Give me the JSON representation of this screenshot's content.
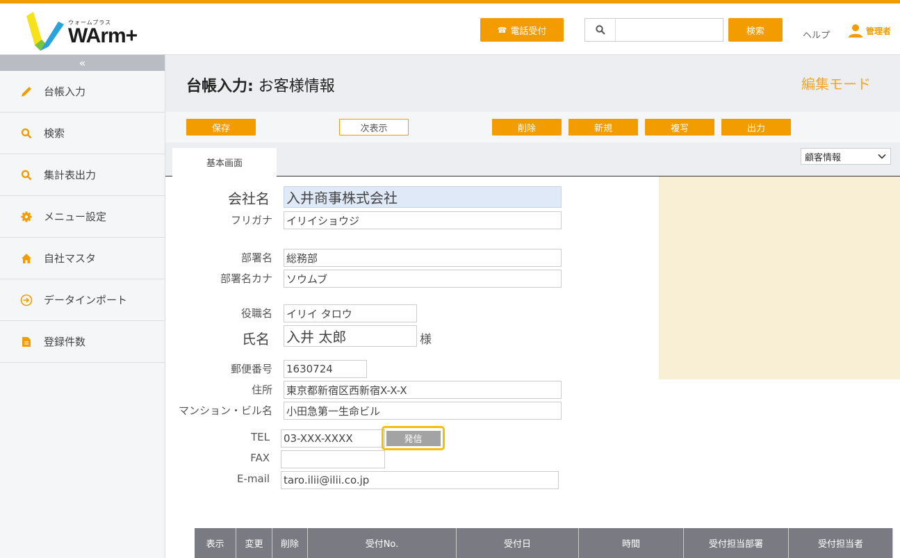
{
  "brand": {
    "sub": "ウォームプラス",
    "main": "WArm+"
  },
  "top": {
    "phone_label": "電話受付",
    "search_placeholder": "",
    "search_label": "検索",
    "help_label": "ヘルプ",
    "user_label": "管理者"
  },
  "sidebar": {
    "collapse": "«",
    "items": [
      {
        "label": "台帳入力",
        "icon": "pencil-icon"
      },
      {
        "label": "検索",
        "icon": "search-icon"
      },
      {
        "label": "集計表出力",
        "icon": "search-icon"
      },
      {
        "label": "メニュー設定",
        "icon": "gear-icon"
      },
      {
        "label": "自社マスタ",
        "icon": "home-icon"
      },
      {
        "label": "データインポート",
        "icon": "import-icon"
      },
      {
        "label": "登録件数",
        "icon": "document-icon"
      }
    ]
  },
  "header": {
    "title_bold": "台帳入力:",
    "title_rest": " お客様情報",
    "mode": "編集モード"
  },
  "toolbar": {
    "save": "保存",
    "next": "次表示",
    "delete": "削除",
    "new": "新規",
    "copy": "複写",
    "output": "出力"
  },
  "tabs": {
    "basic": "基本画面",
    "select_value": "顧客情報"
  },
  "form": {
    "company_label": "会社名",
    "company": "入井商事株式会社",
    "furigana_label": "フリガナ",
    "furigana": "イリイショウジ",
    "dept_label": "部署名",
    "dept": "総務部",
    "dept_kana_label": "部署名カナ",
    "dept_kana": "ソウムブ",
    "position_label": "役職名",
    "position": "イリイ タロウ",
    "name_label": "氏名",
    "name": "入井 太郎",
    "honorific": "様",
    "zip_label": "郵便番号",
    "zip": "1630724",
    "address_label": "住所",
    "address": "東京都新宿区西新宿X-X-X",
    "building_label": "マンション・ビル名",
    "building": "小田急第一生命ビル",
    "tel_label": "TEL",
    "tel": "03-XXX-XXXX",
    "dial": "発信",
    "fax_label": "FAX",
    "fax": "",
    "email_label": "E-mail",
    "email": "taro.ilii@ilii.co.jp"
  },
  "grid": {
    "headers": [
      "表示",
      "変更",
      "削除",
      "受付No.",
      "受付日",
      "時間",
      "受付担当部署",
      "受付担当者"
    ]
  },
  "colors": {
    "accent": "#f39c00",
    "sidebar": "#f5f6f8",
    "panel": "#f8efd4"
  }
}
